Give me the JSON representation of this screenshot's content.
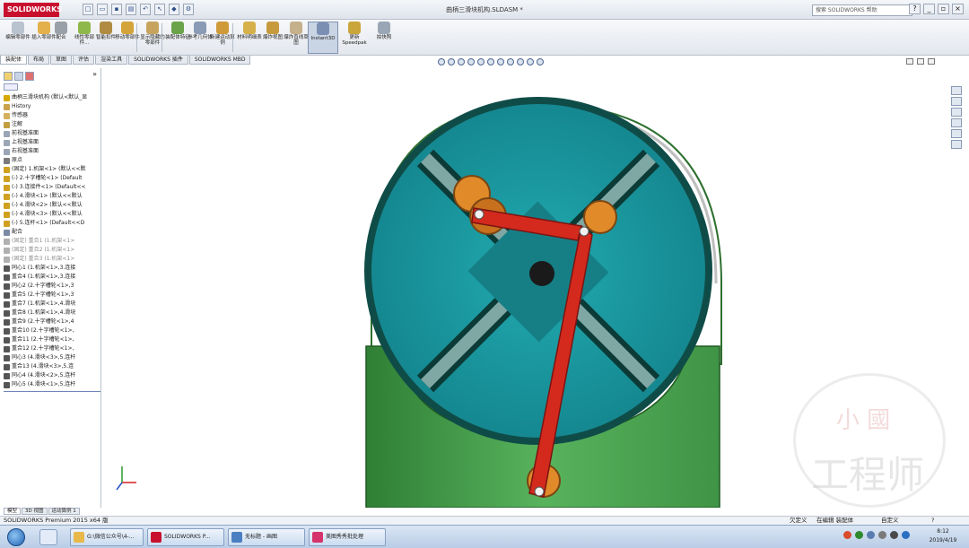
{
  "window": {
    "app_logo": "SOLIDWORKS",
    "title": "曲柄三滑块机构.SLDASM *",
    "search_placeholder": "搜索 SOLIDWORKS 帮助",
    "quick_tools": [
      "new-icon",
      "open-icon",
      "save-icon",
      "print-icon",
      "undo-icon",
      "select-icon",
      "rebuild-icon",
      "options-icon"
    ]
  },
  "ribbon": {
    "buttons": [
      {
        "label": "编辑零部件",
        "icon": "edit-component-icon"
      },
      {
        "label": "插入零部件",
        "icon": "insert-component-icon"
      },
      {
        "label": "配合",
        "icon": "mate-icon"
      },
      {
        "label": "线性零部件...",
        "icon": "linear-pattern-icon"
      },
      {
        "label": "智能扣件",
        "icon": "smart-fastener-icon"
      },
      {
        "label": "移动零部件",
        "icon": "move-component-icon"
      },
      {
        "label": "显示隐藏的零部件",
        "icon": "show-hidden-icon"
      },
      {
        "label": "装配体特征",
        "icon": "assembly-feature-icon"
      },
      {
        "label": "参考几何体",
        "icon": "reference-geometry-icon"
      },
      {
        "label": "新建运动算例",
        "icon": "motion-study-icon"
      },
      {
        "label": "材料明细表",
        "icon": "bom-icon"
      },
      {
        "label": "爆炸视图",
        "icon": "exploded-view-icon"
      },
      {
        "label": "爆炸直线草图",
        "icon": "explode-line-icon"
      },
      {
        "label": "Instant3D",
        "icon": "instant3d-icon"
      },
      {
        "label": "更新Speedpak",
        "icon": "speedpak-icon"
      },
      {
        "label": "拍快照",
        "icon": "snapshot-icon"
      }
    ]
  },
  "tabs": [
    "装配体",
    "布局",
    "草图",
    "评估",
    "渲染工具",
    "SOLIDWORKS 插件",
    "SOLIDWORKS MBD"
  ],
  "tree": {
    "collapse": "»",
    "items": [
      {
        "text": "曲柄三滑块机构 (默认<默认_显",
        "color": "#d7a800",
        "gray": false
      },
      {
        "text": "History",
        "color": "#c9a24a",
        "gray": false
      },
      {
        "text": "传感器",
        "color": "#d4b15c",
        "gray": false
      },
      {
        "text": "注解",
        "color": "#c2a040",
        "gray": false
      },
      {
        "text": "前视基准面",
        "color": "#9aa6b6",
        "gray": false
      },
      {
        "text": "上视基准面",
        "color": "#9aa6b6",
        "gray": false
      },
      {
        "text": "右视基准面",
        "color": "#9aa6b6",
        "gray": false
      },
      {
        "text": "原点",
        "color": "#7a7a7a",
        "gray": false
      },
      {
        "text": "(固定) 1.机架<1> (默认<<默",
        "color": "#d0a020",
        "gray": false
      },
      {
        "text": "(-) 2.十字槽轮<1> (Default",
        "color": "#d0a020",
        "gray": false
      },
      {
        "text": "(-) 3.连接件<1> (Default<<",
        "color": "#d0a020",
        "gray": false
      },
      {
        "text": "(-) 4.滑块<1> (默认<<默认",
        "color": "#d0a020",
        "gray": false
      },
      {
        "text": "(-) 4.滑块<2> (默认<<默认",
        "color": "#d0a020",
        "gray": false
      },
      {
        "text": "(-) 4.滑块<3> (默认<<默认",
        "color": "#d0a020",
        "gray": false
      },
      {
        "text": "(-) 5.连杆<1> (Default<<D",
        "color": "#d0a020",
        "gray": false
      },
      {
        "text": "配合",
        "color": "#7b8aa5",
        "gray": false
      },
      {
        "text": "(固定) 重合1 (1.机架<1>",
        "color": "#b0b0b0",
        "gray": true
      },
      {
        "text": "(固定) 重合2 (1.机架<1>",
        "color": "#b0b0b0",
        "gray": true
      },
      {
        "text": "(固定) 重合3 (1.机架<1>",
        "color": "#b0b0b0",
        "gray": true
      },
      {
        "text": "同心1 (1.机架<1>,3.连接",
        "color": "#555555",
        "gray": false
      },
      {
        "text": "重合4 (1.机架<1>,3.连接",
        "color": "#555555",
        "gray": false
      },
      {
        "text": "同心2 (2.十字槽轮<1>,3",
        "color": "#555555",
        "gray": false
      },
      {
        "text": "重合5 (2.十字槽轮<1>,3",
        "color": "#555555",
        "gray": false
      },
      {
        "text": "重合7 (1.机架<1>,4.滑块",
        "color": "#555555",
        "gray": false
      },
      {
        "text": "重合8 (1.机架<1>,4.滑块",
        "color": "#555555",
        "gray": false
      },
      {
        "text": "重合9 (2.十字槽轮<1>,4",
        "color": "#555555",
        "gray": false
      },
      {
        "text": "重合10 (2.十字槽轮<1>,",
        "color": "#555555",
        "gray": false
      },
      {
        "text": "重合11 (2.十字槽轮<1>,",
        "color": "#555555",
        "gray": false
      },
      {
        "text": "重合12 (2.十字槽轮<1>,",
        "color": "#555555",
        "gray": false
      },
      {
        "text": "同心3 (4.滑块<3>,5.连杆",
        "color": "#555555",
        "gray": false
      },
      {
        "text": "重合13 (4.滑块<3>,5.连",
        "color": "#555555",
        "gray": false
      },
      {
        "text": "同心4 (4.滑块<2>,5.连杆",
        "color": "#555555",
        "gray": false
      },
      {
        "text": "同心5 (4.滑块<1>,5.连杆",
        "color": "#555555",
        "gray": false
      }
    ]
  },
  "watermark": {
    "top": "小 國",
    "bottom": "工程师"
  },
  "model_tabs": [
    "模型",
    "3D 视图",
    "运动算例 1"
  ],
  "status": {
    "product": "SOLIDWORKS Premium 2015 x64 版",
    "state": "欠定义",
    "mode": "在编辑 装配体",
    "custom": "自定义",
    "help": "?"
  },
  "taskbar": {
    "tasks": [
      {
        "label": "G:\\微信公众号\\4-...",
        "icon_color": "#e8b84a"
      },
      {
        "label": "SOLIDWORKS P...",
        "icon_color": "#c8102e"
      },
      {
        "label": "无标题 - 画图",
        "icon_color": "#4a7fc1"
      },
      {
        "label": "美图秀秀批处理",
        "icon_color": "#d6336c"
      }
    ],
    "time": "8:12",
    "date": "2019/4/19"
  },
  "colors": {
    "frame_green": "#4caf50",
    "wheel_teal": "#1b9aa0",
    "link_red": "#d42a1e",
    "slider_orange": "#e08a2a"
  }
}
